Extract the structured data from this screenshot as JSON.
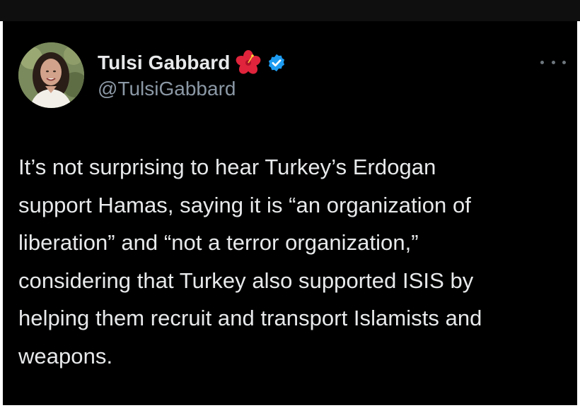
{
  "tweet": {
    "author": {
      "display_name": "Tulsi Gabbard",
      "handle": "@TulsiGabbard",
      "verified": true,
      "name_emoji": "hibiscus-icon"
    },
    "more_menu_icon": "ellipsis-icon",
    "text": "It’s not surprising to hear Turkey’s Erdogan\nsupport Hamas, saying it is “an organization of\nliberation” and “not a terror organization,”\nconsidering that Turkey also supported ISIS by\nhelping them recruit and transport Islamists and\nweapons."
  },
  "colors": {
    "background": "#000000",
    "text": "#e7e9ea",
    "secondary_text": "#8b98a5",
    "verified_badge": "#1d9bf0",
    "hibiscus": "#e0243b"
  }
}
